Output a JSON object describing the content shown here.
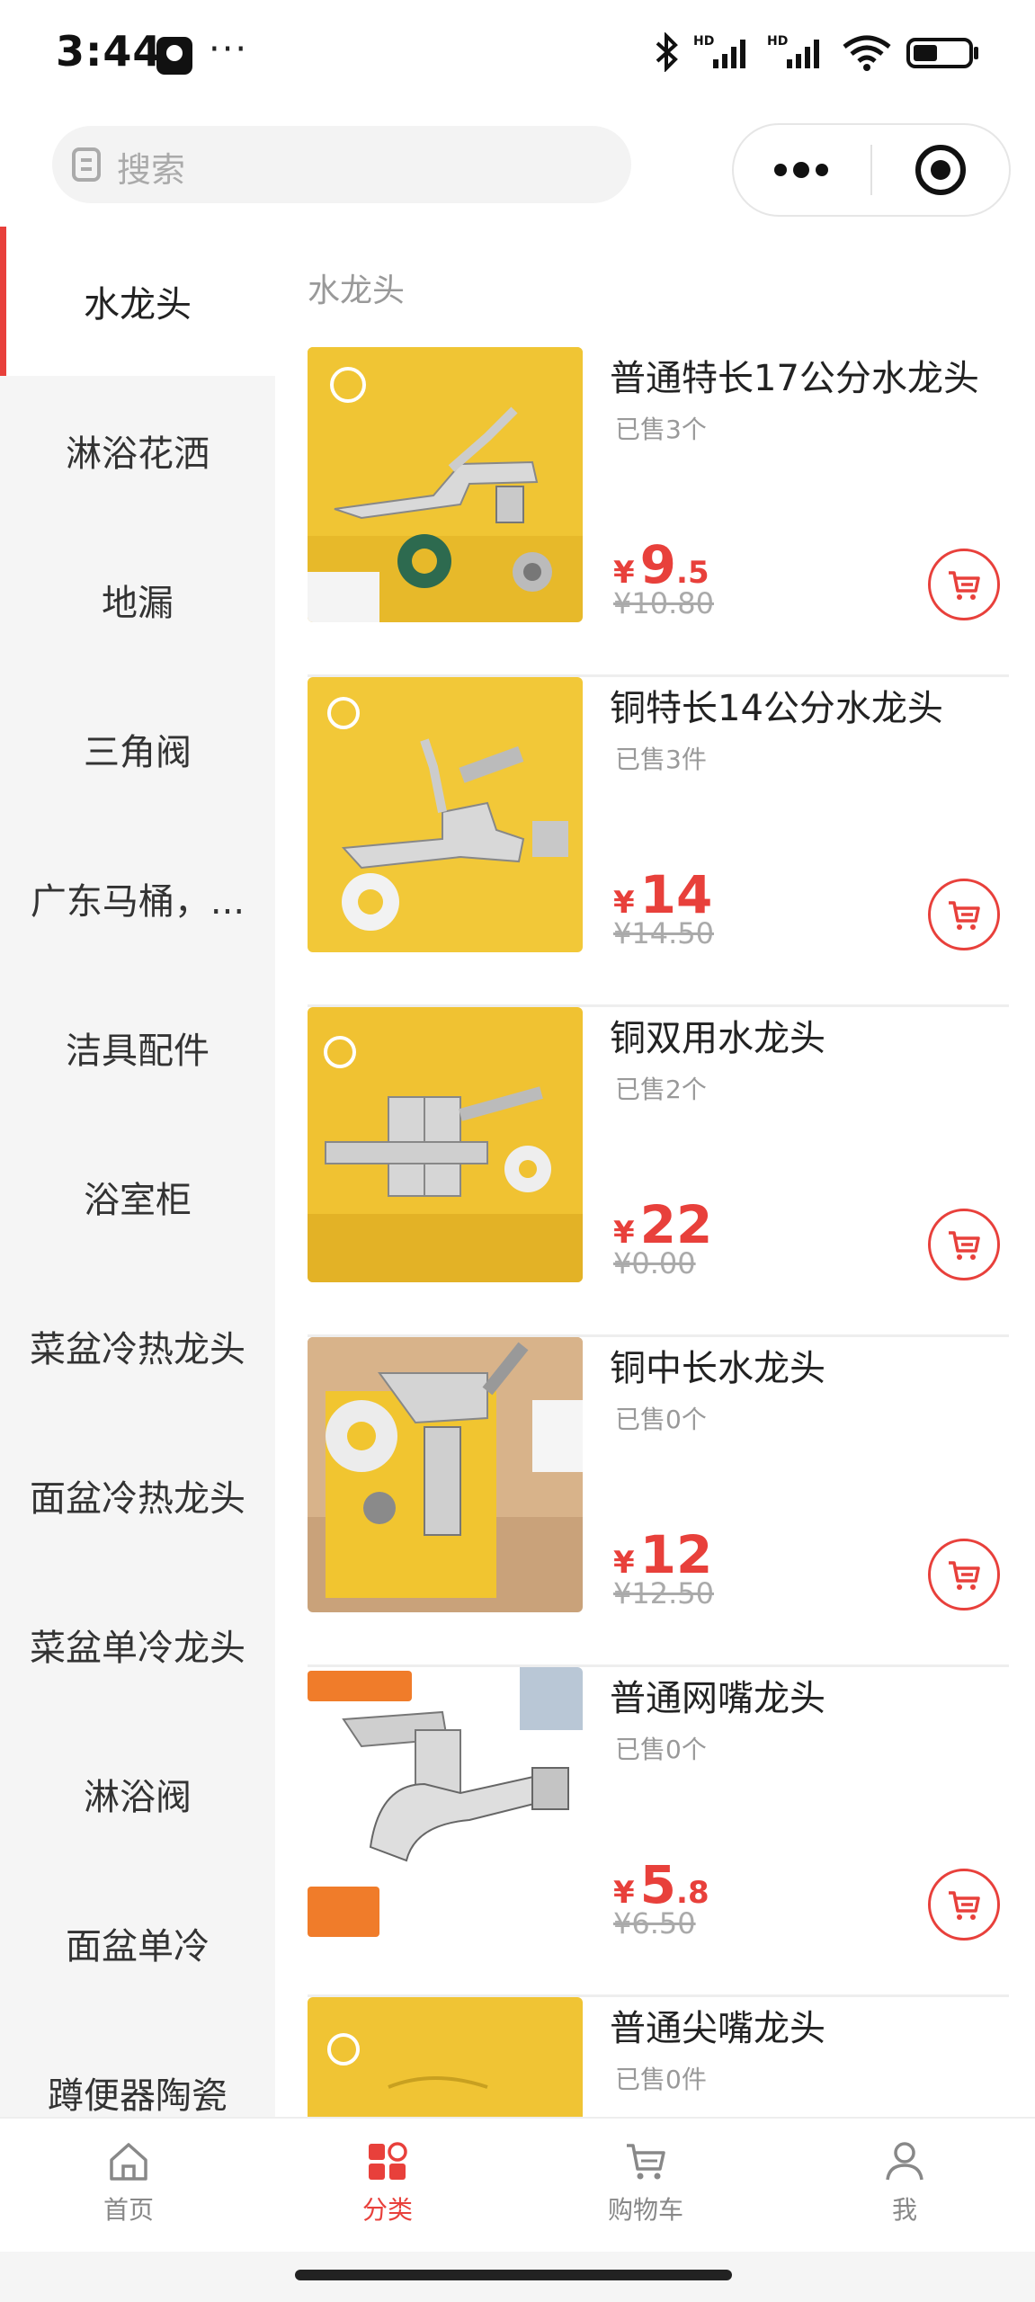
{
  "status_bar": {
    "time": "3:44",
    "dots": "···",
    "battery_level": 0.45
  },
  "header": {
    "search_placeholder": "搜索"
  },
  "sidebar": {
    "items": [
      {
        "label": "水龙头",
        "active": true
      },
      {
        "label": "淋浴花洒"
      },
      {
        "label": "地漏"
      },
      {
        "label": "三角阀"
      },
      {
        "label": "广东马桶，..."
      },
      {
        "label": "洁具配件"
      },
      {
        "label": "浴室柜"
      },
      {
        "label": "菜盆冷热龙头"
      },
      {
        "label": "面盆冷热龙头"
      },
      {
        "label": "菜盆单冷龙头"
      },
      {
        "label": "淋浴阀"
      },
      {
        "label": "面盆单冷"
      },
      {
        "label": "蹲便器陶瓷"
      }
    ]
  },
  "main": {
    "category_title": "水龙头",
    "currency": "¥",
    "products": [
      {
        "name": "普通特长17公分水龙头",
        "sold": "已售3个",
        "price_int": "9",
        "price_dec": ".5",
        "original": "¥10.80",
        "image": "yellow-box-faucet"
      },
      {
        "name": "铜特长14公分水龙头",
        "sold": "已售3件",
        "price_int": "14",
        "price_dec": "",
        "original": "¥14.50",
        "image": "yellow-box-faucet"
      },
      {
        "name": "铜双用水龙头",
        "sold": "已售2个",
        "price_int": "22",
        "price_dec": "",
        "original": "¥0.00",
        "image": "yellow-box-double-faucet"
      },
      {
        "name": "铜中长水龙头",
        "sold": "已售0个",
        "price_int": "12",
        "price_dec": "",
        "original": "¥12.50",
        "image": "wood-table-faucet"
      },
      {
        "name": "普通网嘴龙头",
        "sold": "已售0个",
        "price_int": "5",
        "price_dec": ".8",
        "original": "¥6.50",
        "image": "white-bg-faucet"
      },
      {
        "name": "普通尖嘴龙头",
        "sold": "已售0件",
        "price_int": "",
        "price_dec": "",
        "original": "",
        "image": "yellow-box-faucet"
      }
    ]
  },
  "tab_bar": {
    "items": [
      {
        "label": "首页",
        "icon": "home-icon"
      },
      {
        "label": "分类",
        "icon": "category-icon",
        "active": true
      },
      {
        "label": "购物车",
        "icon": "cart-icon"
      },
      {
        "label": "我",
        "icon": "user-icon"
      }
    ]
  },
  "colors": {
    "accent": "#e8403b",
    "sidebar_bg": "#f5f5f5",
    "muted_text": "#999999"
  }
}
